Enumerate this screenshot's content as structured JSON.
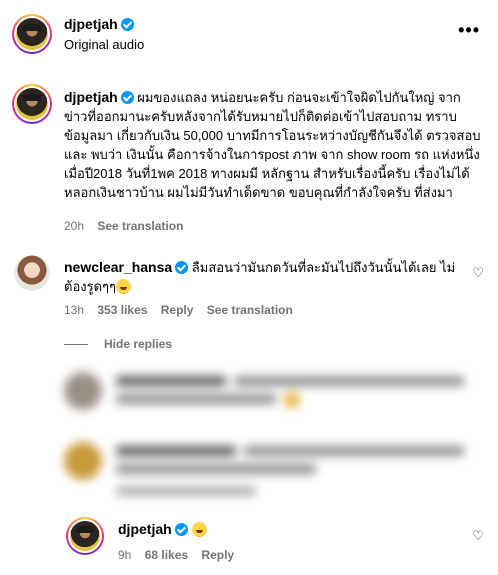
{
  "header": {
    "username": "djpetjah",
    "audio_label": "Original audio",
    "more_label": "•••"
  },
  "caption": {
    "username": "djpetjah",
    "text": "ผมของแถลง หน่อยนะครับ ก่อนจะเข้าใจผิดไปกันใหญ่ จาก ข่าวที่ออกมานะครับหลังจากได้รับหมายไปก็ติดต่อเข้าไปสอบถาม ทราบข้อมูลมา เกี่ยวกับเงิน 50,000 บาทมีการโอนระหว่างบัญชีกันจึงได้ ตรวจสอบ และ พบว่า เงินนั้น คือการจ้างในการpost ภาพ จาก show room รถ แห่งหนึ่ง เมื่อปี2018 วันที่1พค 2018 ทางผมมี หลักฐาน สำหรับเรื่องนี้ครับ เรื่องไม่ได้หลอกเงินชาวบ้าน ผมไม่มีวันทำเด็ดขาด ขอบคุณที่กำลังใจครับ ที่ส่งมา",
    "time": "20h",
    "see_translation": "See translation"
  },
  "comment1": {
    "username": "newclear_hansa",
    "text": "ลืมสอนว่ามันกดวันที่ละมันไปถึงวันนั้นได้เลย ไม่ต้องรูดๆๆ",
    "time": "13h",
    "likes": "353 likes",
    "reply": "Reply",
    "see_translation": "See translation",
    "heart": "♡"
  },
  "hide_replies": "Hide replies",
  "reply3": {
    "username": "djpetjah",
    "time": "9h",
    "likes": "68 likes",
    "reply": "Reply",
    "heart": "♡"
  }
}
